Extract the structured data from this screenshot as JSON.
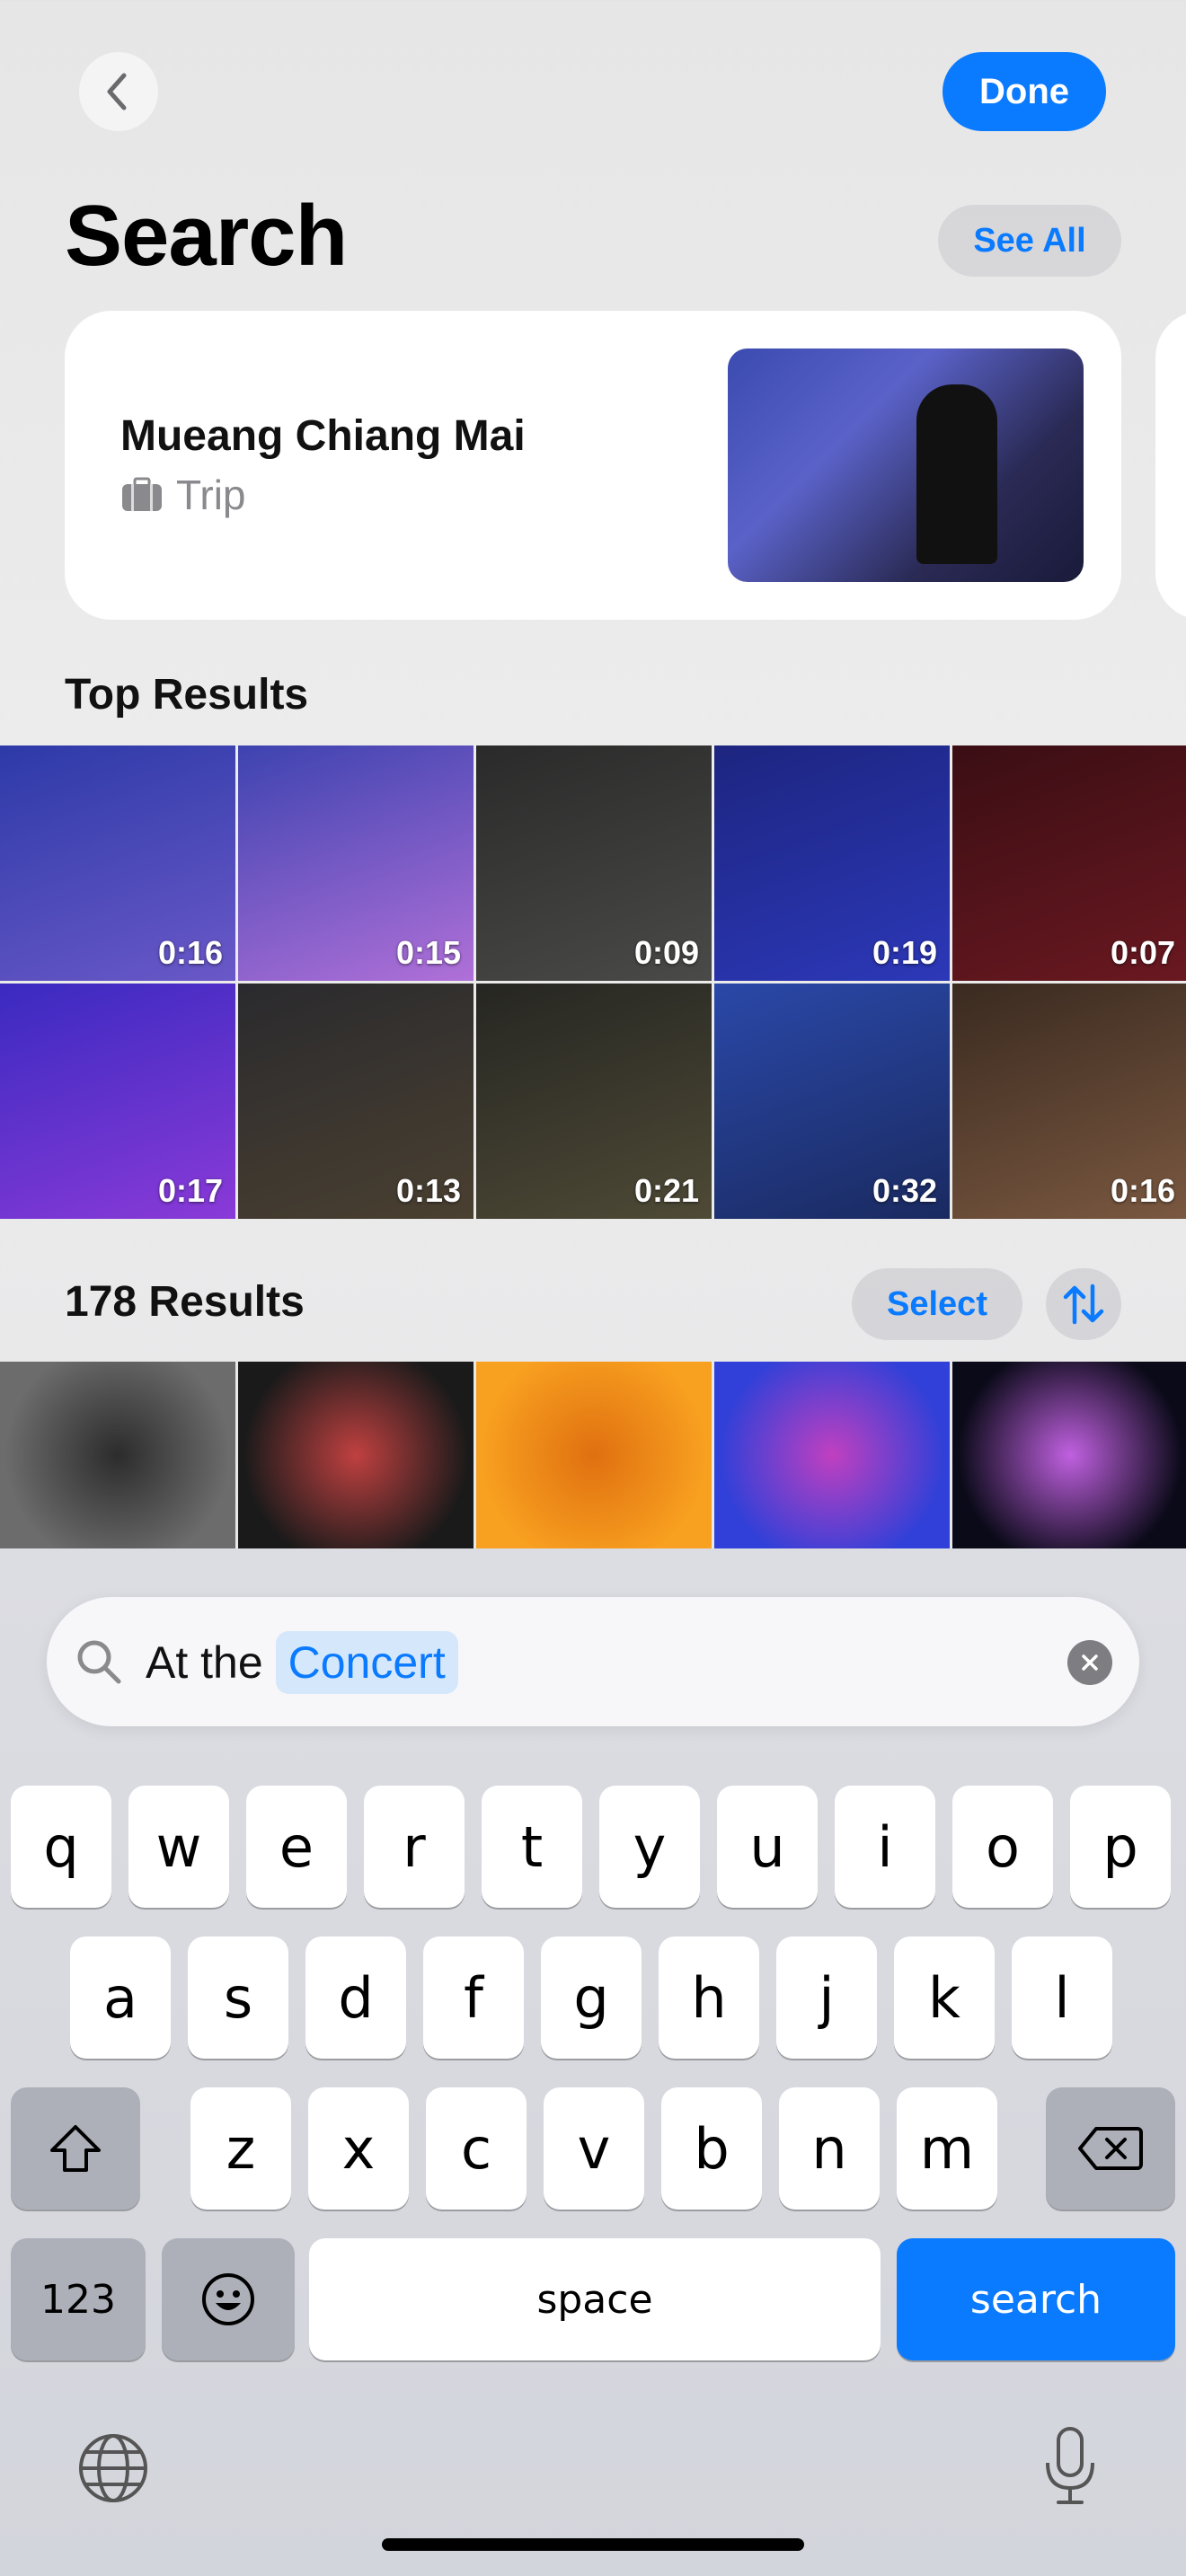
{
  "header": {
    "back_icon": "chevron-left-icon",
    "done_label": "Done",
    "title": "Search",
    "see_all_label": "See All"
  },
  "memory_card": {
    "title": "Mueang Chiang Mai",
    "type_icon": "suitcase-icon",
    "type_label": "Trip"
  },
  "top_results": {
    "label": "Top Results",
    "tiles": [
      {
        "duration": "0:16",
        "colors": [
          "#2d3aa8",
          "#6a58c8"
        ]
      },
      {
        "duration": "0:15",
        "colors": [
          "#3d43b0",
          "#b070d8"
        ]
      },
      {
        "duration": "0:09",
        "colors": [
          "#2a2a2a",
          "#4a4a48"
        ]
      },
      {
        "duration": "0:19",
        "colors": [
          "#1d2580",
          "#2c38b8"
        ]
      },
      {
        "duration": "0:07",
        "colors": [
          "#3a0e14",
          "#6a1820"
        ]
      },
      {
        "duration": "0:17",
        "colors": [
          "#3a2ac0",
          "#8a3ad8"
        ]
      },
      {
        "duration": "0:13",
        "colors": [
          "#2a2a2e",
          "#4a4030"
        ]
      },
      {
        "duration": "0:21",
        "colors": [
          "#262622",
          "#4e4a36"
        ]
      },
      {
        "duration": "0:32",
        "colors": [
          "#2a48a8",
          "#1a2a60"
        ]
      },
      {
        "duration": "0:16",
        "colors": [
          "#3a2a20",
          "#7a5840"
        ]
      }
    ]
  },
  "all_results": {
    "label": "178 Results",
    "select_label": "Select",
    "sort_icon": "sort-arrows-icon",
    "tiles": [
      {
        "colors": [
          "#6c6c6c",
          "#2c2c2c"
        ]
      },
      {
        "colors": [
          "#1a1a1a",
          "#c04040"
        ]
      },
      {
        "colors": [
          "#f8a020",
          "#e07010"
        ]
      },
      {
        "colors": [
          "#3040d8",
          "#c040c0"
        ]
      },
      {
        "colors": [
          "#0a0a18",
          "#c060e0"
        ]
      }
    ]
  },
  "search": {
    "icon": "magnifying-glass-icon",
    "prefix": "At the",
    "token": "Concert",
    "clear_icon": "clear-x-icon"
  },
  "keyboard": {
    "row1": [
      "q",
      "w",
      "e",
      "r",
      "t",
      "y",
      "u",
      "i",
      "o",
      "p"
    ],
    "row2": [
      "a",
      "s",
      "d",
      "f",
      "g",
      "h",
      "j",
      "k",
      "l"
    ],
    "row3": [
      "z",
      "x",
      "c",
      "v",
      "b",
      "n",
      "m"
    ],
    "shift_icon": "shift-arrow-icon",
    "delete_icon": "delete-backspace-icon",
    "numbers_label": "123",
    "emoji_icon": "emoji-smiley-icon",
    "space_label": "space",
    "search_label": "search",
    "globe_icon": "globe-icon",
    "mic_icon": "microphone-icon"
  },
  "colors": {
    "accent": "#0a7aff",
    "keyboard_bg": "#d3d5dc",
    "function_key": "#adb0b9"
  }
}
